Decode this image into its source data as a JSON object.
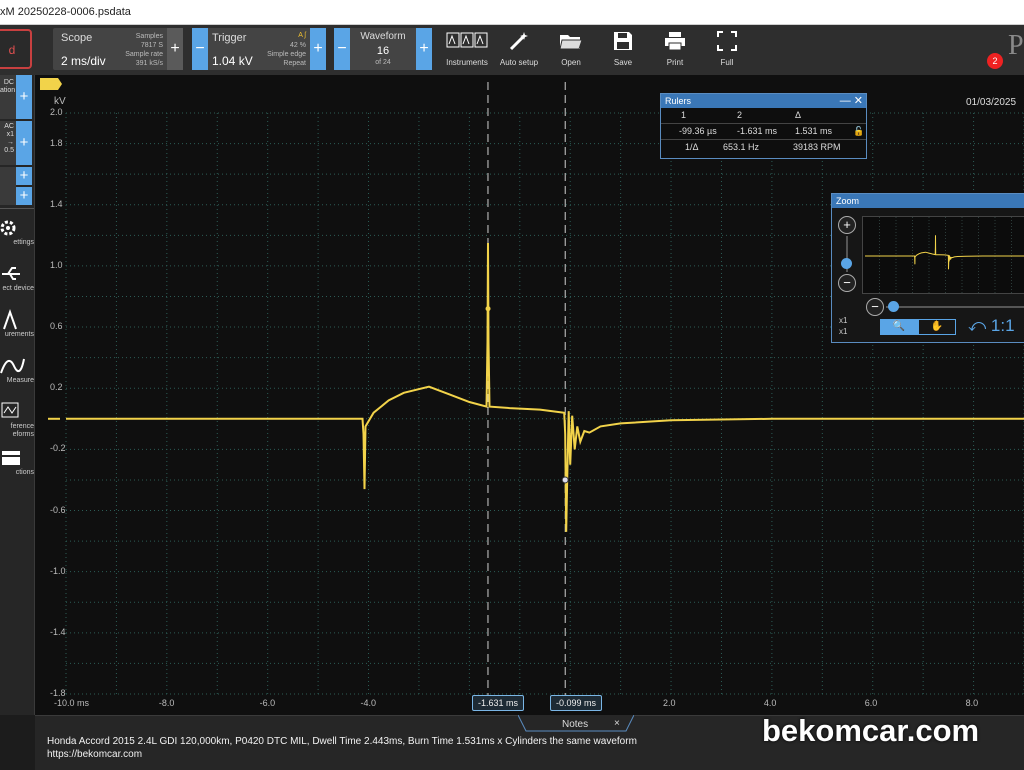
{
  "window": {
    "title": "xM 20250228-0006.psdata"
  },
  "toolbar": {
    "red_button_label": "d",
    "scope": {
      "label": "Scope",
      "value": "2 ms/div",
      "samples_label": "Samples",
      "samples_value": "7817 S",
      "rate_label": "Sample rate",
      "rate_value": "391 kS/s"
    },
    "trigger": {
      "label": "Trigger",
      "value": "1.04 kV",
      "mode_icon": "A ʃ",
      "percent": "42 %",
      "type": "Simple edge",
      "repeat": "Repeat"
    },
    "waveform": {
      "label": "Waveform",
      "value": "16",
      "of": "of 24"
    },
    "tools": [
      {
        "name": "instruments",
        "label": "Instruments"
      },
      {
        "name": "auto-setup",
        "label": "Auto setup"
      },
      {
        "name": "open",
        "label": "Open"
      },
      {
        "name": "save",
        "label": "Save"
      },
      {
        "name": "print",
        "label": "Print"
      },
      {
        "name": "full",
        "label": "Full"
      }
    ],
    "badge": "2",
    "logo_fragment": "P"
  },
  "sidebar": {
    "channels": [
      {
        "line1": "DC",
        "line2": "ation"
      },
      {
        "line1": "AC",
        "line2": "x1",
        "line3": "→ 0.5"
      }
    ],
    "items": [
      {
        "label": "ettings",
        "icon": "gear-icon"
      },
      {
        "label": "ect device",
        "icon": "usb-icon"
      },
      {
        "label": "urements",
        "icon": "measurement-icon"
      },
      {
        "label": "Measure",
        "icon": "math-icon"
      },
      {
        "label": "ference",
        "label2": "eforms",
        "icon": "reference-icon"
      },
      {
        "label": "ctions",
        "icon": "actions-icon"
      }
    ]
  },
  "plot": {
    "unit": "kV",
    "date": "01/03/2025",
    "cursor1": "-1.631 ms",
    "cursor2": "-0.099 ms"
  },
  "rulers": {
    "title": "Rulers",
    "col1": "1",
    "col2": "2",
    "col3": "Δ",
    "v1": "-99.36 µs",
    "v2": "-1.631 ms",
    "v3": "1.531 ms",
    "inv_label": "1/Δ",
    "freq": "653.1 Hz",
    "rpm": "39183 RPM"
  },
  "zoom": {
    "title": "Zoom",
    "x1a": "x1",
    "x1b": "x1",
    "ratio": "1:1"
  },
  "notes": {
    "tab": "Notes",
    "line1": "Honda Accord 2015 2.4L GDI 120,000km, P0420 DTC MIL,  Dwell Time 2.443ms, Burn Time 1.531ms x Cylinders the same waveform",
    "line2": "https://bekomcar.com"
  },
  "watermark": "bekomcar.com",
  "chart_data": {
    "type": "line",
    "xlabel": "",
    "ylabel": "kV",
    "xlim": [
      -10.0,
      9.0
    ],
    "ylim": [
      -1.8,
      2.0
    ],
    "x_ticks": [
      "-10.0 ms",
      "-8.0",
      "-6.0",
      "-4.0",
      "-2.0",
      "0.0",
      "2.0",
      "4.0",
      "6.0",
      "8.0"
    ],
    "y_ticks": [
      "2.0",
      "1.8",
      "1.4",
      "1.0",
      "0.6",
      "0.2",
      "-0.2",
      "-0.6",
      "-1.0",
      "-1.4",
      "-1.8"
    ],
    "series": [
      {
        "color": "#f2d34a",
        "points": [
          [
            -10.0,
            0.0
          ],
          [
            -5.0,
            0.0
          ],
          [
            -4.12,
            0.0
          ],
          [
            -4.1,
            -0.1
          ],
          [
            -4.08,
            -0.46
          ],
          [
            -4.06,
            -0.05
          ],
          [
            -3.9,
            0.04
          ],
          [
            -3.6,
            0.12
          ],
          [
            -3.3,
            0.17
          ],
          [
            -2.8,
            0.21
          ],
          [
            -2.4,
            0.16
          ],
          [
            -2.0,
            0.11
          ],
          [
            -1.66,
            0.08
          ],
          [
            -1.64,
            0.5
          ],
          [
            -1.63,
            1.15
          ],
          [
            -1.62,
            0.5
          ],
          [
            -1.6,
            0.08
          ],
          [
            -1.2,
            0.07
          ],
          [
            -0.6,
            0.06
          ],
          [
            -0.12,
            0.04
          ],
          [
            -0.1,
            -0.1
          ],
          [
            -0.08,
            -0.74
          ],
          [
            -0.06,
            -0.4
          ],
          [
            -0.03,
            0.05
          ],
          [
            0.0,
            -0.3
          ],
          [
            0.04,
            0.02
          ],
          [
            0.09,
            -0.2
          ],
          [
            0.14,
            -0.05
          ],
          [
            0.2,
            -0.15
          ],
          [
            0.28,
            -0.08
          ],
          [
            0.38,
            -0.09
          ],
          [
            0.6,
            -0.05
          ],
          [
            1.0,
            -0.03
          ],
          [
            2.0,
            -0.01
          ],
          [
            4.0,
            0.0
          ],
          [
            6.0,
            0.0
          ],
          [
            9.0,
            0.0
          ]
        ]
      }
    ]
  }
}
